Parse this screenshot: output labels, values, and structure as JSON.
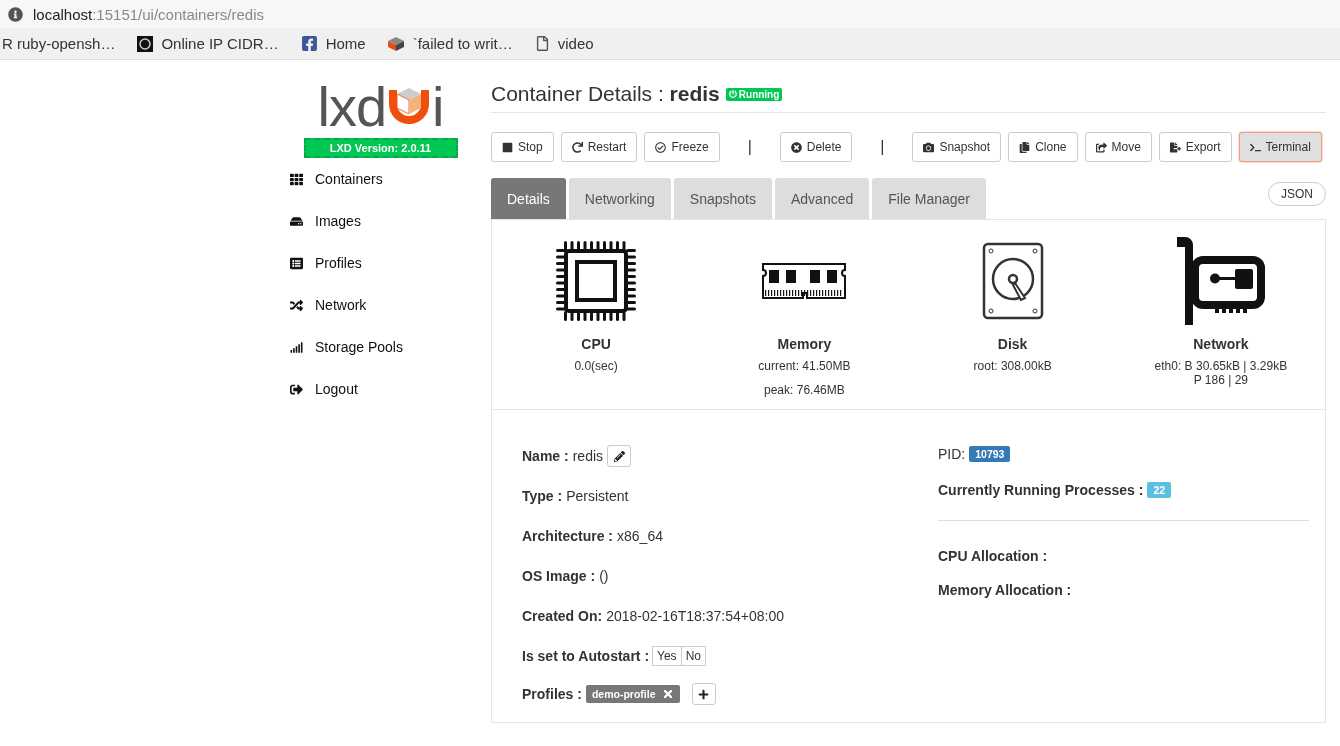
{
  "browser": {
    "url_host": "localhost",
    "url_path": ":15151/ui/containers/redis",
    "bookmarks": [
      {
        "label": "R ruby-opensh…",
        "kind": "none"
      },
      {
        "label": "Online IP CIDR…",
        "kind": "circle"
      },
      {
        "label": "Home",
        "kind": "facebook"
      },
      {
        "label": "`failed to writ…",
        "kind": "cube"
      },
      {
        "label": "video",
        "kind": "page"
      }
    ]
  },
  "sidebar": {
    "logo": {
      "left": "lxd",
      "right": "i"
    },
    "version": "LXD Version: 2.0.11",
    "items": [
      {
        "label": "Containers",
        "kind": "grid"
      },
      {
        "label": "Images",
        "kind": "drive"
      },
      {
        "label": "Profiles",
        "kind": "list"
      },
      {
        "label": "Network",
        "kind": "shuffle"
      },
      {
        "label": "Storage Pools",
        "kind": "bars"
      },
      {
        "label": "Logout",
        "kind": "logout"
      }
    ]
  },
  "header": {
    "title": "Container Details : ",
    "name": "redis",
    "status": "Running"
  },
  "actions": [
    [
      {
        "label": "Stop",
        "kind": "stop",
        "active": false
      },
      {
        "label": "Restart",
        "kind": "restart",
        "active": false
      },
      {
        "label": "Freeze",
        "kind": "freeze",
        "active": false
      }
    ],
    [
      {
        "label": "Delete",
        "kind": "delete",
        "active": false
      }
    ],
    [
      {
        "label": "Snapshot",
        "kind": "camera",
        "active": false
      },
      {
        "label": "Clone",
        "kind": "copy",
        "active": false
      },
      {
        "label": "Move",
        "kind": "move",
        "active": false
      },
      {
        "label": "Export",
        "kind": "export",
        "active": false
      },
      {
        "label": "Terminal",
        "kind": "terminal",
        "active": true
      }
    ]
  ],
  "separators": [
    "|",
    "|"
  ],
  "tabs": [
    {
      "label": "Details",
      "selected": true
    },
    {
      "label": "Networking",
      "selected": false
    },
    {
      "label": "Snapshots",
      "selected": false
    },
    {
      "label": "Advanced",
      "selected": false
    },
    {
      "label": "File Manager",
      "selected": false
    }
  ],
  "json_button": "JSON",
  "stats": [
    {
      "kind": "cpu",
      "title": "CPU",
      "lines": [
        "0.0(sec)"
      ]
    },
    {
      "kind": "memory",
      "title": "Memory",
      "lines": [
        "current: 41.50MB",
        "peak: 76.46MB"
      ]
    },
    {
      "kind": "disk",
      "title": "Disk",
      "lines": [
        "root: 308.00kB"
      ]
    },
    {
      "kind": "network",
      "title": "Network",
      "lines": [
        "eth0: B 30.65kB | 3.29kB",
        "P 186 | 29"
      ]
    }
  ],
  "details": [
    {
      "kind": "edit",
      "label": "Name :",
      "value": "redis"
    },
    {
      "kind": "text",
      "label": "Type :",
      "value": "Persistent"
    },
    {
      "kind": "text",
      "label": "Architecture :",
      "value": "x86_64"
    },
    {
      "kind": "text",
      "label": "OS Image :",
      "value": "()"
    },
    {
      "kind": "text",
      "label": "Created On:",
      "value": "2018-02-16T18:37:54+08:00"
    },
    {
      "kind": "toggle",
      "label": "Is set to Autostart :",
      "options": [
        "Yes",
        "No"
      ]
    },
    {
      "kind": "tags",
      "label": "Profiles :",
      "tags": [
        "demo-profile"
      ]
    }
  ],
  "runtime": [
    {
      "label": "PID:",
      "bold": false,
      "badge": "10793",
      "color": "#337ab7"
    },
    {
      "label": "Currently Running Processes :",
      "bold": true,
      "badge": "22",
      "color": "#5bc0de"
    }
  ],
  "allocation": [
    {
      "label": "CPU Allocation :"
    },
    {
      "label": "Memory Allocation :"
    }
  ]
}
